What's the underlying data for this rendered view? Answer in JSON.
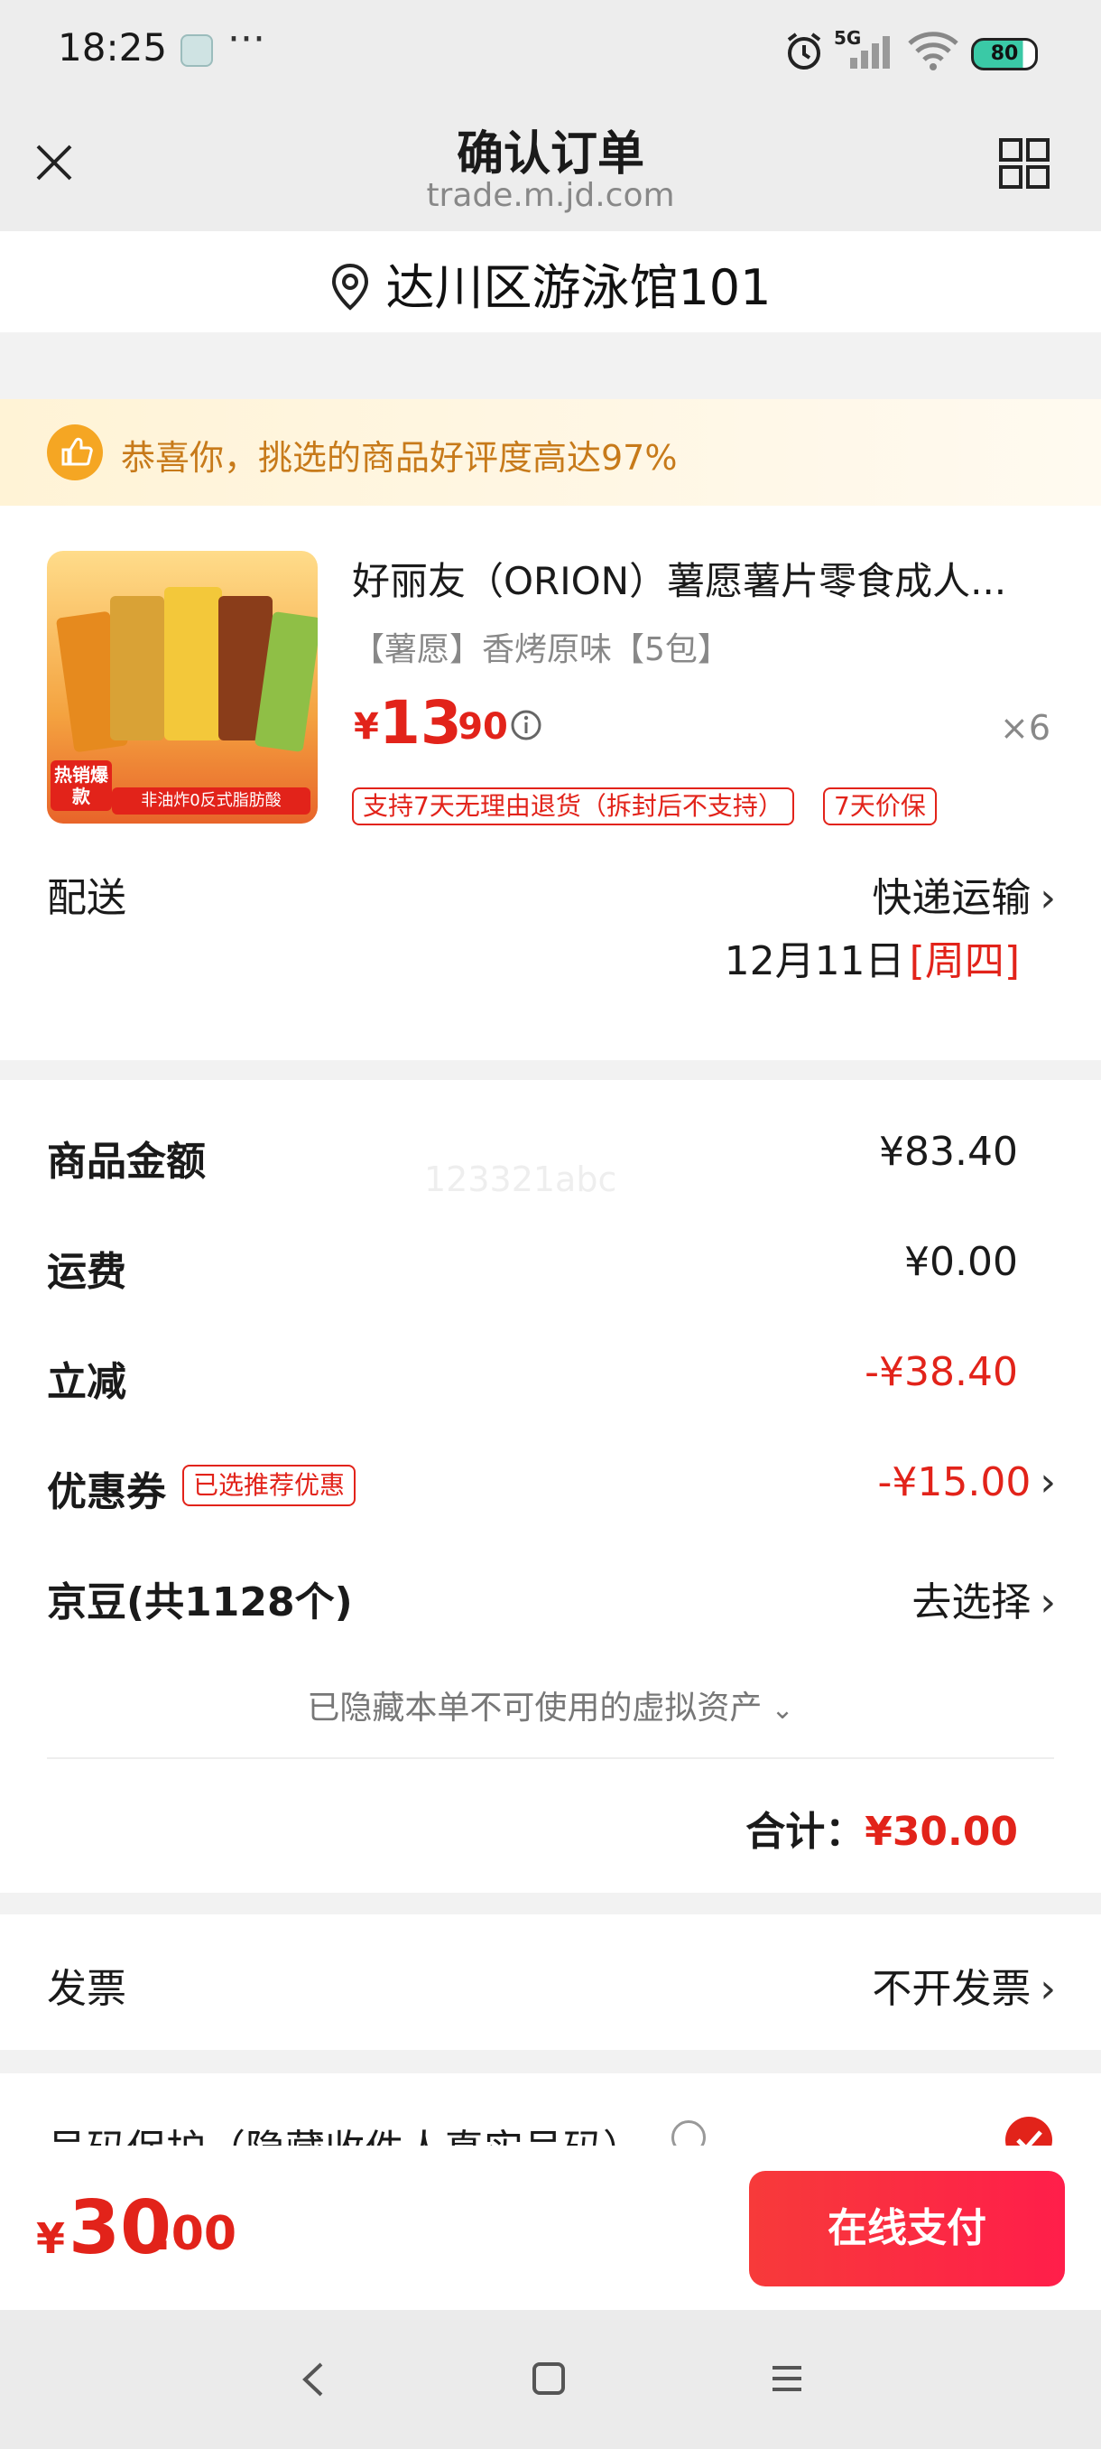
{
  "status_bar": {
    "time": "18:25",
    "more": "···",
    "network": "5G",
    "battery": "80"
  },
  "header": {
    "title": "确认订单",
    "subtitle": "trade.m.jd.com"
  },
  "address": {
    "text": "达川区游泳馆101"
  },
  "banner": {
    "text": "恭喜你，挑选的商品好评度高达97%"
  },
  "product": {
    "name": "好丽友（ORION）薯愿薯片零食成人...",
    "spec": "【薯愿】香烤原味【5包】",
    "price_symbol": "¥",
    "price_int": "13",
    "price_dec": ".90",
    "quantity": "×6",
    "tags": [
      "支持7天无理由退货（拆封后不支持）",
      "7天价保"
    ],
    "image_badge_1": "热销爆款",
    "image_badge_2": "非油炸0反式脂肪酸"
  },
  "delivery": {
    "label": "配送",
    "method": "快递运输",
    "date": "12月11日",
    "weekday": "[周四]"
  },
  "summary": {
    "goods_amount_label": "商品金额",
    "goods_amount": "¥83.40",
    "watermark": "123321abc",
    "shipping_label": "运费",
    "shipping": "¥0.00",
    "discount_label": "立减",
    "discount": "-¥38.40",
    "coupon_label": "优惠券",
    "coupon_tag": "已选推荐优惠",
    "coupon": "-¥15.00",
    "jingdou_label": "京豆(共1128个)",
    "jingdou_action": "去选择",
    "hidden_assets": "已隐藏本单不可使用的虚拟资产",
    "total_label": "合计：",
    "total": "¥30.00"
  },
  "invoice": {
    "label": "发票",
    "value": "不开发票"
  },
  "privacy": {
    "label": "号码保护（隐藏收件人真实号码）"
  },
  "bottom": {
    "price_symbol": "¥",
    "price_int": "30",
    "price_dec": ".00",
    "pay_label": "在线支付"
  },
  "colors": {
    "accent": "#e2231a",
    "pay_button": "#f73a3a"
  }
}
